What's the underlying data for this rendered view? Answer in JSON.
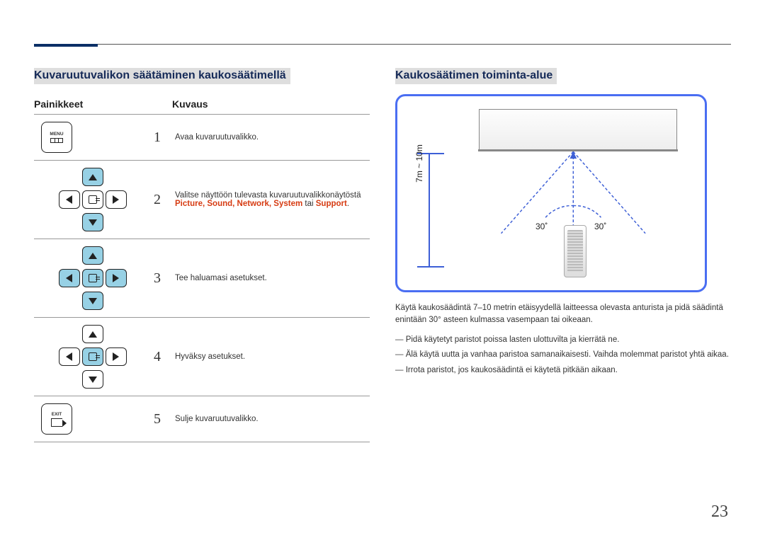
{
  "left": {
    "title": "Kuvaruutuvalikon säätäminen kaukosäätimellä",
    "col_buttons": "Painikkeet",
    "col_desc": "Kuvaus",
    "rows": [
      {
        "num": "1",
        "desc": "Avaa kuvaruutuvalikko."
      },
      {
        "num": "2",
        "desc_lead": "Valitse näyttöön tulevasta kuvaruutuvalikkonäytöstä",
        "red_parts": "Picture, Sound, Network, System",
        "mid": " tai ",
        "red_last": "Support",
        "tail": "."
      },
      {
        "num": "3",
        "desc": "Tee haluamasi asetukset."
      },
      {
        "num": "4",
        "desc": "Hyväksy asetukset."
      },
      {
        "num": "5",
        "desc": "Sulje kuvaruutuvalikko."
      }
    ],
    "menu_label": "MENU",
    "exit_label": "EXIT"
  },
  "right": {
    "title": "Kaukosäätimen toiminta-alue",
    "distance": "7m ~ 10m",
    "angle_left": "30˚",
    "angle_right": "30˚",
    "paragraph": "Käytä kaukosäädintä 7–10 metrin etäisyydellä laitteessa olevasta anturista ja pidä säädintä enintään 30° asteen kulmassa vasempaan tai oikeaan.",
    "notes": [
      "Pidä käytetyt paristot poissa lasten ulottuvilta ja kierrätä ne.",
      "Älä käytä uutta ja vanhaa paristoa samanaikaisesti. Vaihda molemmat paristot yhtä aikaa.",
      "Irrota paristot, jos kaukosäädintä ei käytetä pitkään aikaan."
    ]
  },
  "page_number": "23"
}
